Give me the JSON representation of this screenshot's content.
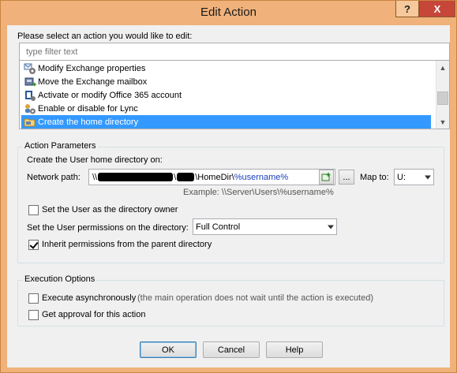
{
  "window": {
    "title": "Edit Action",
    "help_glyph": "?",
    "close_glyph": "X"
  },
  "prompt": "Please select an action you would like to edit:",
  "filter": {
    "placeholder": "type filter text"
  },
  "actions": [
    {
      "label": "Modify Exchange properties",
      "icon": "exchange-gear-icon"
    },
    {
      "label": "Move the Exchange mailbox",
      "icon": "mailbox-move-icon"
    },
    {
      "label": "Activate or modify Office 365 account",
      "icon": "office365-icon"
    },
    {
      "label": "Enable or disable for Lync",
      "icon": "lync-icon"
    },
    {
      "label": "Create the home directory",
      "icon": "folder-icon",
      "selected": true
    }
  ],
  "action_parameters": {
    "title": "Action Parameters",
    "intro": "Create the User home directory on:",
    "network_path_label": "Network path:",
    "network_path_prefix": "\\\\",
    "network_path_mid": "\\HomeDir\\",
    "network_path_var": "%username%",
    "example": "Example: \\\\Server\\Users\\%username%",
    "browse_label": "...",
    "map_to_label": "Map to:",
    "map_to_value": "U:",
    "owner_label": "Set the User as the directory owner",
    "owner_checked": false,
    "permissions_label": "Set the User permissions on the directory:",
    "permissions_value": "Full Control",
    "inherit_label": "Inherit permissions from the parent directory",
    "inherit_checked": true
  },
  "execution_options": {
    "title": "Execution Options",
    "async_label": "Execute asynchronously",
    "async_note": "(the main operation does not wait until the action is executed)",
    "async_checked": false,
    "approval_label": "Get approval for this action",
    "approval_checked": false
  },
  "buttons": {
    "ok": "OK",
    "cancel": "Cancel",
    "help": "Help"
  },
  "colors": {
    "accent": "#3399ff",
    "title_bar": "#f0b27a",
    "close": "#c7463a",
    "variable_text": "#1a3fbf"
  }
}
